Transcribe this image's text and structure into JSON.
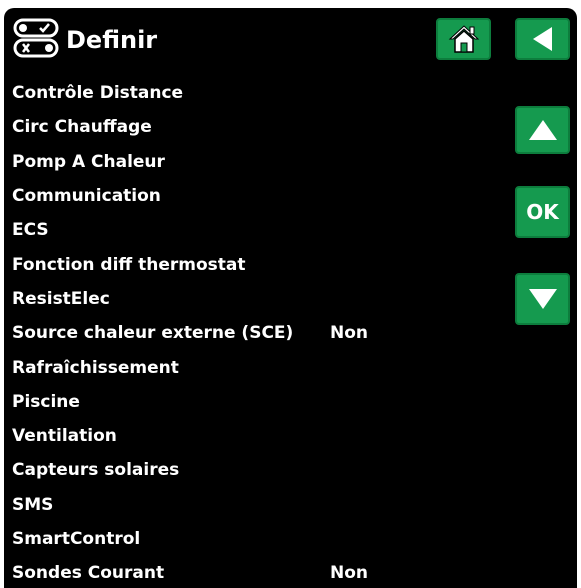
{
  "header": {
    "title": "Definir",
    "icon": "settings-toggle-icon"
  },
  "nav": {
    "home_icon": "home-icon",
    "back_icon": "back-arrow-icon",
    "up_icon": "up-arrow-icon",
    "ok_label": "OK",
    "down_icon": "down-arrow-icon",
    "button_color": "#159a4f"
  },
  "menu": {
    "items": [
      {
        "label": "Contrôle Distance",
        "value": ""
      },
      {
        "label": "Circ Chauffage",
        "value": ""
      },
      {
        "label": "Pomp A Chaleur",
        "value": ""
      },
      {
        "label": "Communication",
        "value": ""
      },
      {
        "label": "ECS",
        "value": ""
      },
      {
        "label": "Fonction diff thermostat",
        "value": ""
      },
      {
        "label": "ResistElec",
        "value": ""
      },
      {
        "label": "Source chaleur externe (SCE)",
        "value": "Non"
      },
      {
        "label": "Rafraîchissement",
        "value": ""
      },
      {
        "label": "Piscine",
        "value": ""
      },
      {
        "label": "Ventilation",
        "value": ""
      },
      {
        "label": "Capteurs solaires",
        "value": ""
      },
      {
        "label": "SMS",
        "value": ""
      },
      {
        "label": "SmartControl",
        "value": ""
      },
      {
        "label": "Sondes Courant",
        "value": "Non"
      }
    ]
  }
}
